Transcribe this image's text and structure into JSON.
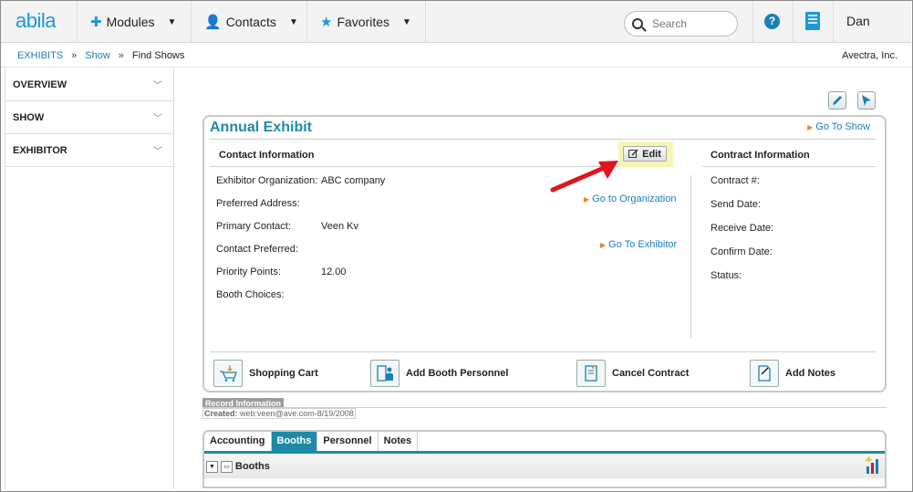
{
  "app": {
    "logo": "abila",
    "user": "Dan"
  },
  "nav": {
    "modules": "Modules",
    "contacts": "Contacts",
    "favorites": "Favorites",
    "search_placeholder": "Search",
    "help_symbol": "?"
  },
  "breadcrumb": {
    "items": [
      "EXHIBITS",
      "Show",
      "Find Shows"
    ],
    "separator": "»",
    "company": "Avectra, Inc."
  },
  "sidebar": {
    "items": [
      {
        "label": "OVERVIEW"
      },
      {
        "label": "SHOW"
      },
      {
        "label": "EXHIBITOR"
      }
    ]
  },
  "record": {
    "title": "Annual Exhibit",
    "go_to_show": "Go To Show",
    "contact_section": "Contact Information",
    "contract_section": "Contract Information",
    "edit_label": "Edit",
    "go_to_org": "Go to Organization",
    "go_to_exhibitor": "Go To Exhibitor",
    "fields": [
      {
        "label": "Exhibitor Organization:",
        "value": "ABC company"
      },
      {
        "label": "Preferred Address:",
        "value": ""
      },
      {
        "label": "Primary Contact:",
        "value": "Veen Kv"
      },
      {
        "label": "Contact Preferred:",
        "value": ""
      },
      {
        "label": "Priority Points:",
        "value": "12.00"
      },
      {
        "label": "Booth Choices:",
        "value": ""
      }
    ],
    "contract_fields": [
      "Contract #:",
      "Send Date:",
      "Receive Date:",
      "Confirm Date:",
      "Status:"
    ],
    "actions": [
      "Shopping Cart",
      "Add Booth Personnel",
      "Cancel Contract",
      "Add Notes"
    ]
  },
  "record_info": {
    "label": "Record Information",
    "created_prefix": "Created:",
    "created_value": "web:veen@ave.com-8/19/2008"
  },
  "tabs": {
    "items": [
      "Accounting",
      "Booths",
      "Personnel",
      "Notes"
    ],
    "active": "Booths",
    "section_title": "Booths"
  },
  "colors": {
    "accent": "#1a9ad6",
    "teal": "#1e8aa8",
    "highlight": "#f7f5b5",
    "arrow": "#e0141b"
  }
}
